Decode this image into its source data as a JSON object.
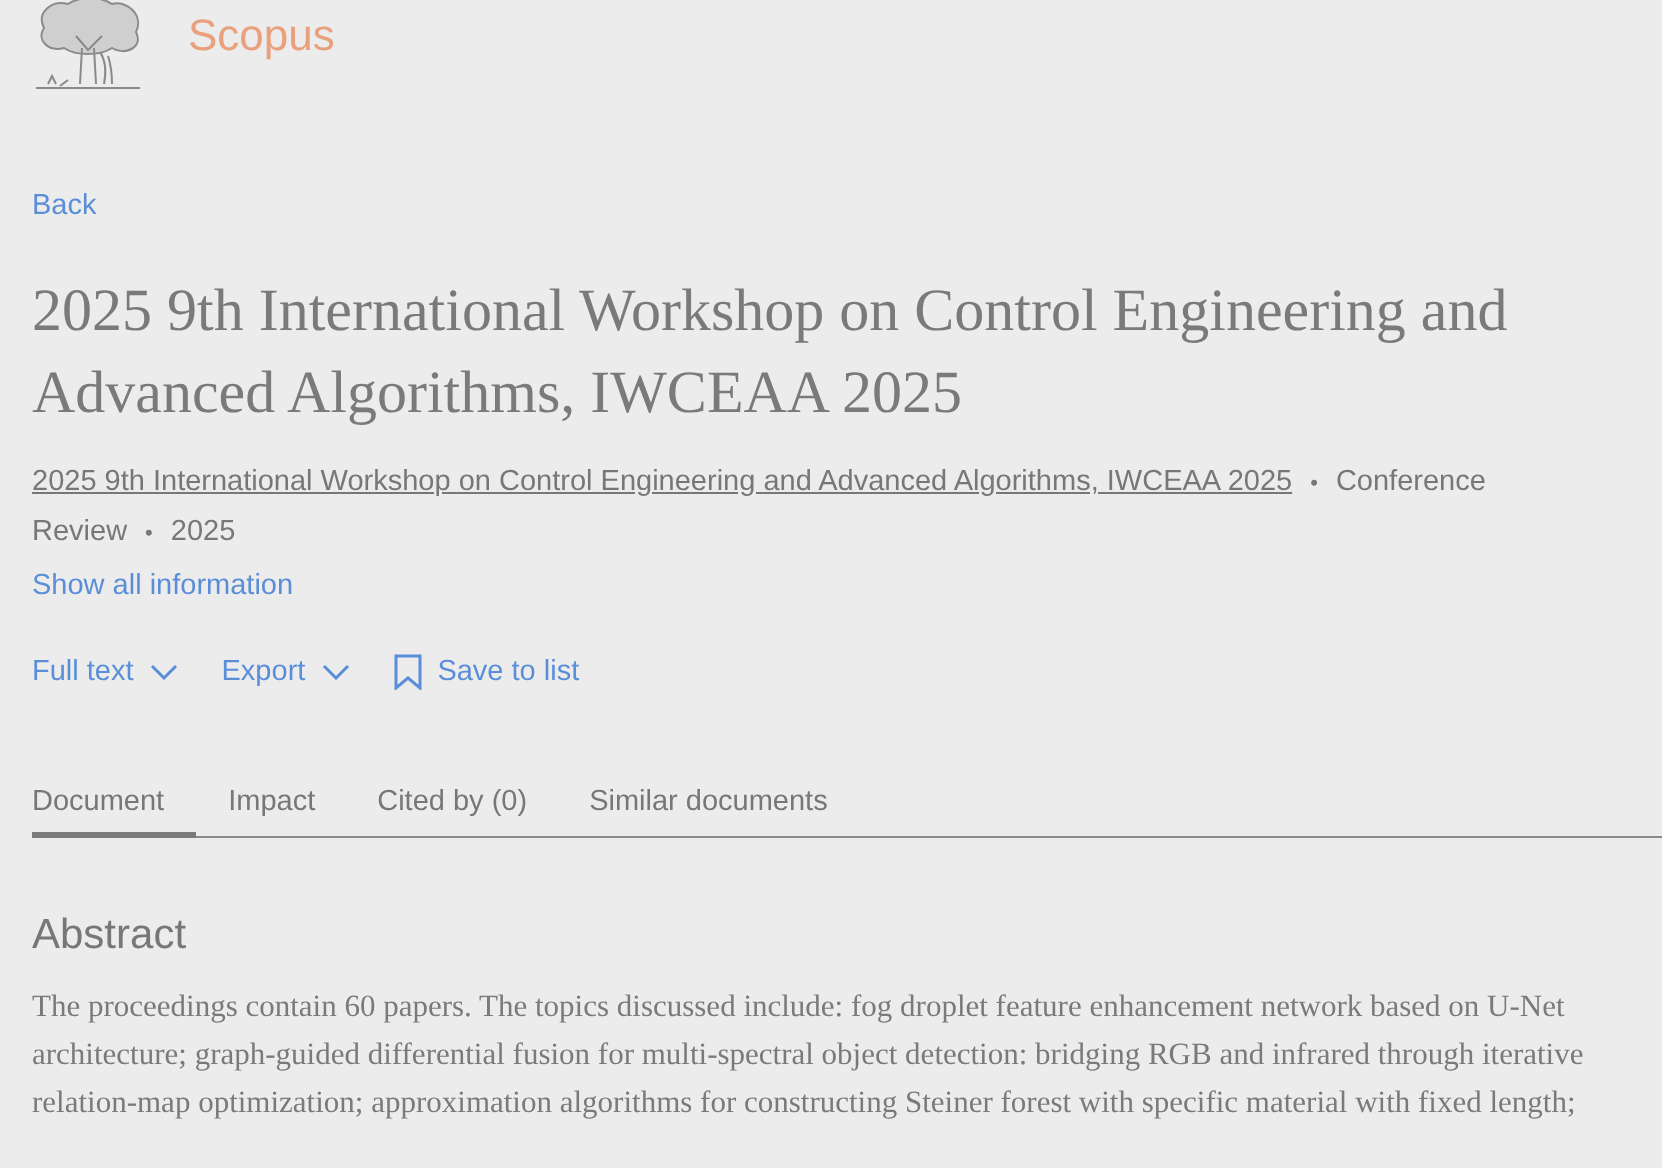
{
  "brand": {
    "name": "Scopus"
  },
  "back_link": "Back",
  "title": "2025 9th International Workshop on Control Engineering and Advanced Algorithms, IWCEAA 2025",
  "source": {
    "link": "2025 9th International Workshop on Control Engineering and Advanced Algorithms, IWCEAA 2025",
    "separator": "•",
    "details": [
      {
        "text": "Conference",
        "after_separator": true
      },
      {
        "text": "Review",
        "after_separator": false
      },
      {
        "text": "2025",
        "after_separator": true
      }
    ]
  },
  "show_all_link": "Show all information",
  "actions": [
    {
      "label": "Full text",
      "kind": "dropdown"
    },
    {
      "label": "Export",
      "kind": "dropdown"
    },
    {
      "label": "Save to list",
      "kind": "bookmark"
    }
  ],
  "tabs": [
    {
      "label": "Document",
      "selected": true
    },
    {
      "label": "Impact",
      "selected": false
    },
    {
      "label": "Cited by (0)",
      "selected": false
    },
    {
      "label": "Similar documents",
      "selected": false
    }
  ],
  "abstract": {
    "heading": "Abstract",
    "lines": [
      "The proceedings contain 60 papers. The topics discussed include: fog droplet feature enhancement network based on U-Net",
      "architecture; graph-guided differential fusion for multi-spectral object detection: bridging RGB and infrared through iterative",
      "relation-map optimization; approximation algorithms for constructing Steiner forest with specific material with fixed length;"
    ]
  }
}
